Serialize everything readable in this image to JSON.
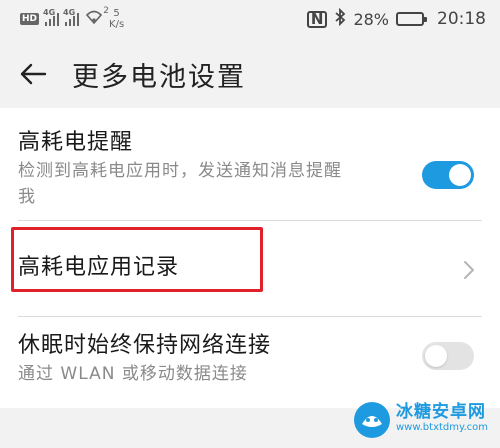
{
  "status_bar": {
    "hd": "HD",
    "sim1": "4G",
    "sim2": "4G",
    "wifi_sup": "2",
    "speed_value": "5",
    "speed_unit": "K/s",
    "nfc": "N",
    "battery_percent_text": "28%",
    "battery_level": 0.28,
    "time": "20:18"
  },
  "header": {
    "title": "更多电池设置"
  },
  "settings": {
    "high_power_reminder": {
      "title": "高耗电提醒",
      "subtitle_line1": "检测到高耗电应用时，发送通知消息提醒",
      "subtitle_line2": "我",
      "enabled": true
    },
    "high_power_records": {
      "title": "高耗电应用记录"
    },
    "keep_network_sleep": {
      "title": "休眠时始终保持网络连接",
      "subtitle": "通过 WLAN 或移动数据连接",
      "enabled": false
    }
  },
  "colors": {
    "accent": "#1e9ae0",
    "highlight": "#e0202a",
    "background": "#f2f2f2"
  },
  "watermark": {
    "name": "冰糖安卓网",
    "url": "www.btxtdmy.com"
  }
}
